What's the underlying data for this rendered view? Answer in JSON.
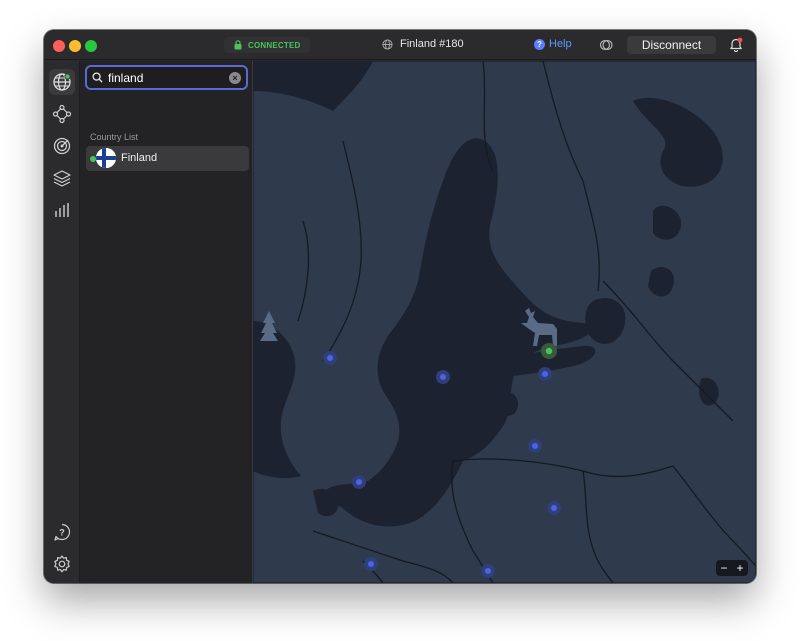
{
  "titlebar": {
    "status": "CONNECTED",
    "server": "Finland #180",
    "help_label": "Help",
    "disconnect_label": "Disconnect"
  },
  "search": {
    "value": "finland"
  },
  "country_list": {
    "label": "Country List",
    "items": [
      {
        "name": "Finland",
        "connected": true
      }
    ]
  },
  "icons": {
    "rail_top": [
      "globe-icon",
      "meshnet-icon",
      "threat-protection-icon",
      "layers-icon",
      "stats-icon"
    ],
    "rail_bottom": [
      "help-icon",
      "settings-icon"
    ]
  },
  "colors": {
    "accent": "#5b6bd6",
    "connected": "#4cc25a",
    "help": "#5a9cff",
    "map_water": "#1e2532",
    "map_land": "#2f3a4d",
    "server_dot": "#4f62e6"
  },
  "map": {
    "zoom_out": "−",
    "zoom_in": "+"
  }
}
